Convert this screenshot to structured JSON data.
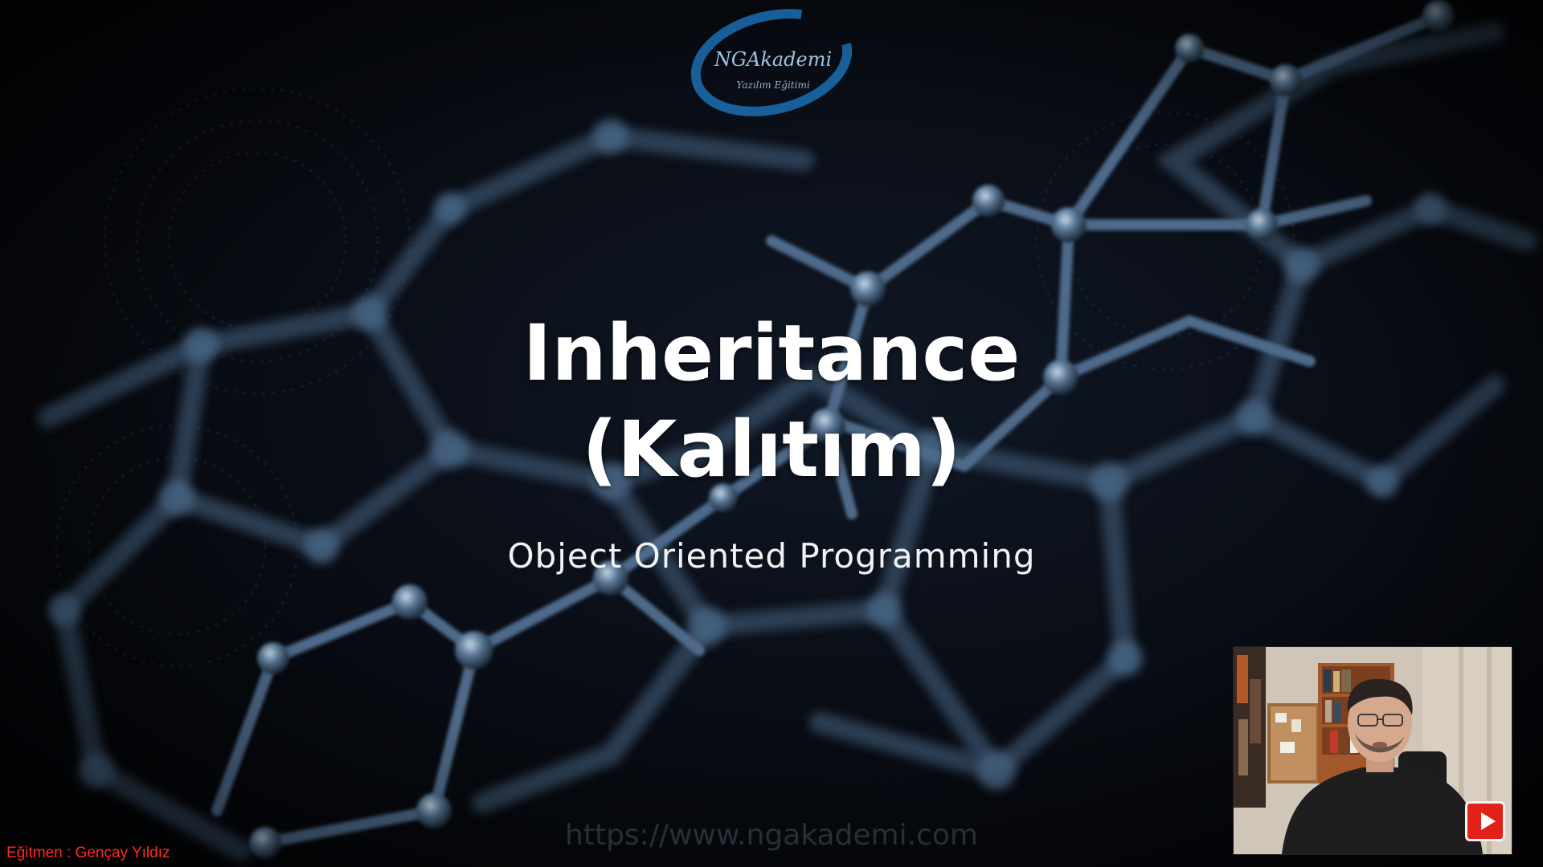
{
  "slide": {
    "logo": {
      "brand": "NGAkademi",
      "tagline": "Yazılım Eğitimi",
      "icon": "ngakademi-logo-icon"
    },
    "title_line1": "Inheritance",
    "title_line2": "(Kalıtım)",
    "subtitle": "Object Oriented Programming",
    "watermark_url": "https://www.ngakademi.com",
    "instructor": "Eğitmen : Gençay Yıldız"
  },
  "webcam": {
    "icon": "play-icon",
    "play_button_color": "#e1211a"
  },
  "colors": {
    "background": "#05070b",
    "molecule": "#3b5877",
    "title": "#ffffff",
    "instructor_text": "#ff2a1f",
    "logo_blue": "#1b6fb3"
  }
}
